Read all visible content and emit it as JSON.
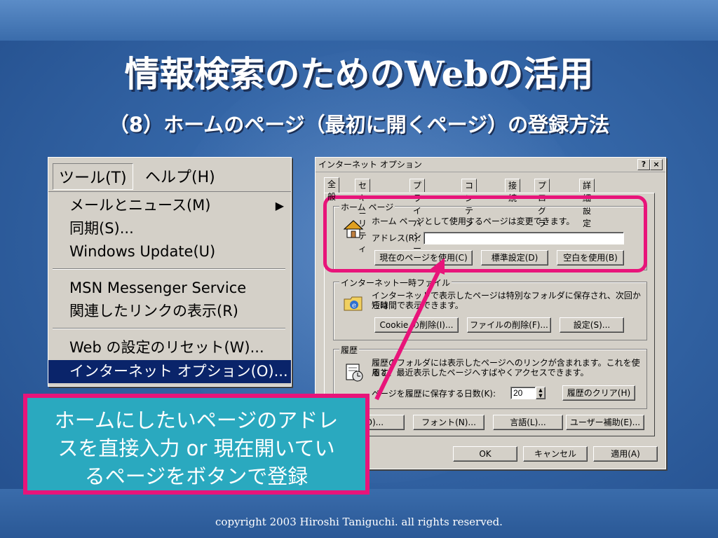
{
  "slide": {
    "title": "情報検索のためのWebの活用",
    "subtitle": "（8）ホームのページ（最初に開くページ）の登録方法",
    "copyright": "copyright 2003 Hiroshi Taniguchi. all rights reserved."
  },
  "menu": {
    "bar": [
      "ツール(T)",
      "ヘルプ(H)"
    ],
    "items": [
      "メールとニュース(M)",
      "同期(S)...",
      "Windows Update(U)",
      "MSN Messenger Service",
      "関連したリンクの表示(R)",
      "Web の設定のリセット(W)...",
      "インターネット オプション(O)..."
    ],
    "submenu_arrow": "▶"
  },
  "dialog": {
    "title": "インターネット オプション",
    "help_btn": "?",
    "close_btn": "×",
    "tabs": [
      "全般",
      "セキュリティ",
      "プライバシー",
      "コンテンツ",
      "接続",
      "プログラム",
      "詳細設定"
    ],
    "home": {
      "label": "ホーム ページ",
      "desc": "ホーム ページとして使用するページは変更できます。",
      "address_label": "アドレス(R):",
      "address_value": "",
      "btn_current": "現在のページを使用(C)",
      "btn_default": "標準設定(D)",
      "btn_blank": "空白を使用(B)"
    },
    "temp": {
      "label": "インターネット一時ファイル",
      "desc1": "インターネットで表示したページは特別なフォルダに保存され、次回からは",
      "desc2": "短時間で表示できます。",
      "btn_cookie": "Cookie の削除(I)...",
      "btn_files": "ファイルの削除(F)...",
      "btn_settings": "設定(S)..."
    },
    "history": {
      "label": "履歴",
      "desc1": "履歴のフォルダには表示したページへのリンクが含まれます。これを使用す",
      "desc2": "ると、最近表示したページへすばやくアクセスできます。",
      "days_label": "ページを履歴に保存する日数(K):",
      "days_value": "20",
      "btn_clear": "履歴のクリア(H)"
    },
    "bottom_buttons": [
      "色(O)...",
      "フォント(N)...",
      "言語(L)...",
      "ユーザー補助(E)..."
    ],
    "ok": "OK",
    "cancel": "キャンセル",
    "apply": "適用(A)"
  },
  "callout": {
    "line1": "ホームにしたいページのアドレ",
    "line2": "スを直接入力 or 現在開いてい",
    "line3": "るページをボタンで登録"
  },
  "colors": {
    "highlight": "#e8147a",
    "callout_bg": "#2aa9bf",
    "menu_selected": "#0a246a"
  }
}
